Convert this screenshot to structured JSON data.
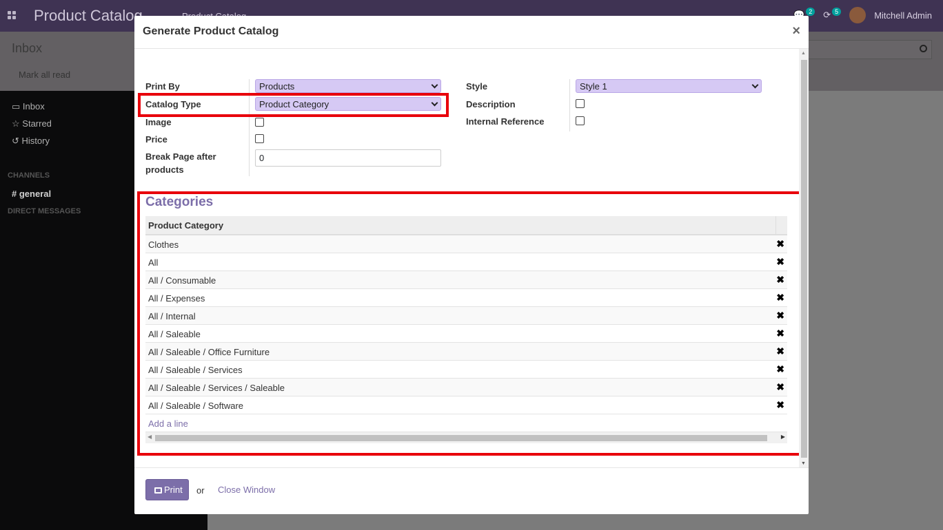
{
  "app": {
    "title": "Product Catalog",
    "breadcrumb": "Product Catalog",
    "messages_count": "2",
    "activities_count": "5",
    "user": "Mitchell Admin"
  },
  "control": {
    "title": "Inbox",
    "mark_all_read": "Mark all read"
  },
  "sidebar": {
    "items": [
      {
        "label": "Inbox",
        "icon": "inbox-icon"
      },
      {
        "label": "Starred",
        "icon": "star-icon"
      },
      {
        "label": "History",
        "icon": "history-icon"
      }
    ],
    "channels_header": "CHANNELS",
    "channel": "general",
    "dm_header": "DIRECT MESSAGES"
  },
  "modal": {
    "title": "Generate Product Catalog",
    "close": "×",
    "form": {
      "print_by_label": "Print By",
      "print_by_value": "Products",
      "catalog_type_label": "Catalog Type",
      "catalog_type_value": "Product Category",
      "image_label": "Image",
      "price_label": "Price",
      "break_page_label": "Break Page after products",
      "break_page_value": "0",
      "style_label": "Style",
      "style_value": "Style 1",
      "description_label": "Description",
      "internal_ref_label": "Internal Reference"
    },
    "categories": {
      "title": "Categories",
      "column": "Product Category",
      "rows": [
        "Clothes",
        "All",
        "All / Consumable",
        "All / Expenses",
        "All / Internal",
        "All / Saleable",
        "All / Saleable / Office Furniture",
        "All / Saleable / Services",
        "All / Saleable / Services / Saleable",
        "All / Saleable / Software"
      ],
      "add_line": "Add a line",
      "delete_glyph": "✖"
    },
    "footer": {
      "print": "Print",
      "or": "or",
      "close_window": "Close Window"
    }
  },
  "colors": {
    "brand": "#7c6ea9",
    "highlight": "#e8000b",
    "select_bg": "#d6c9f4"
  }
}
